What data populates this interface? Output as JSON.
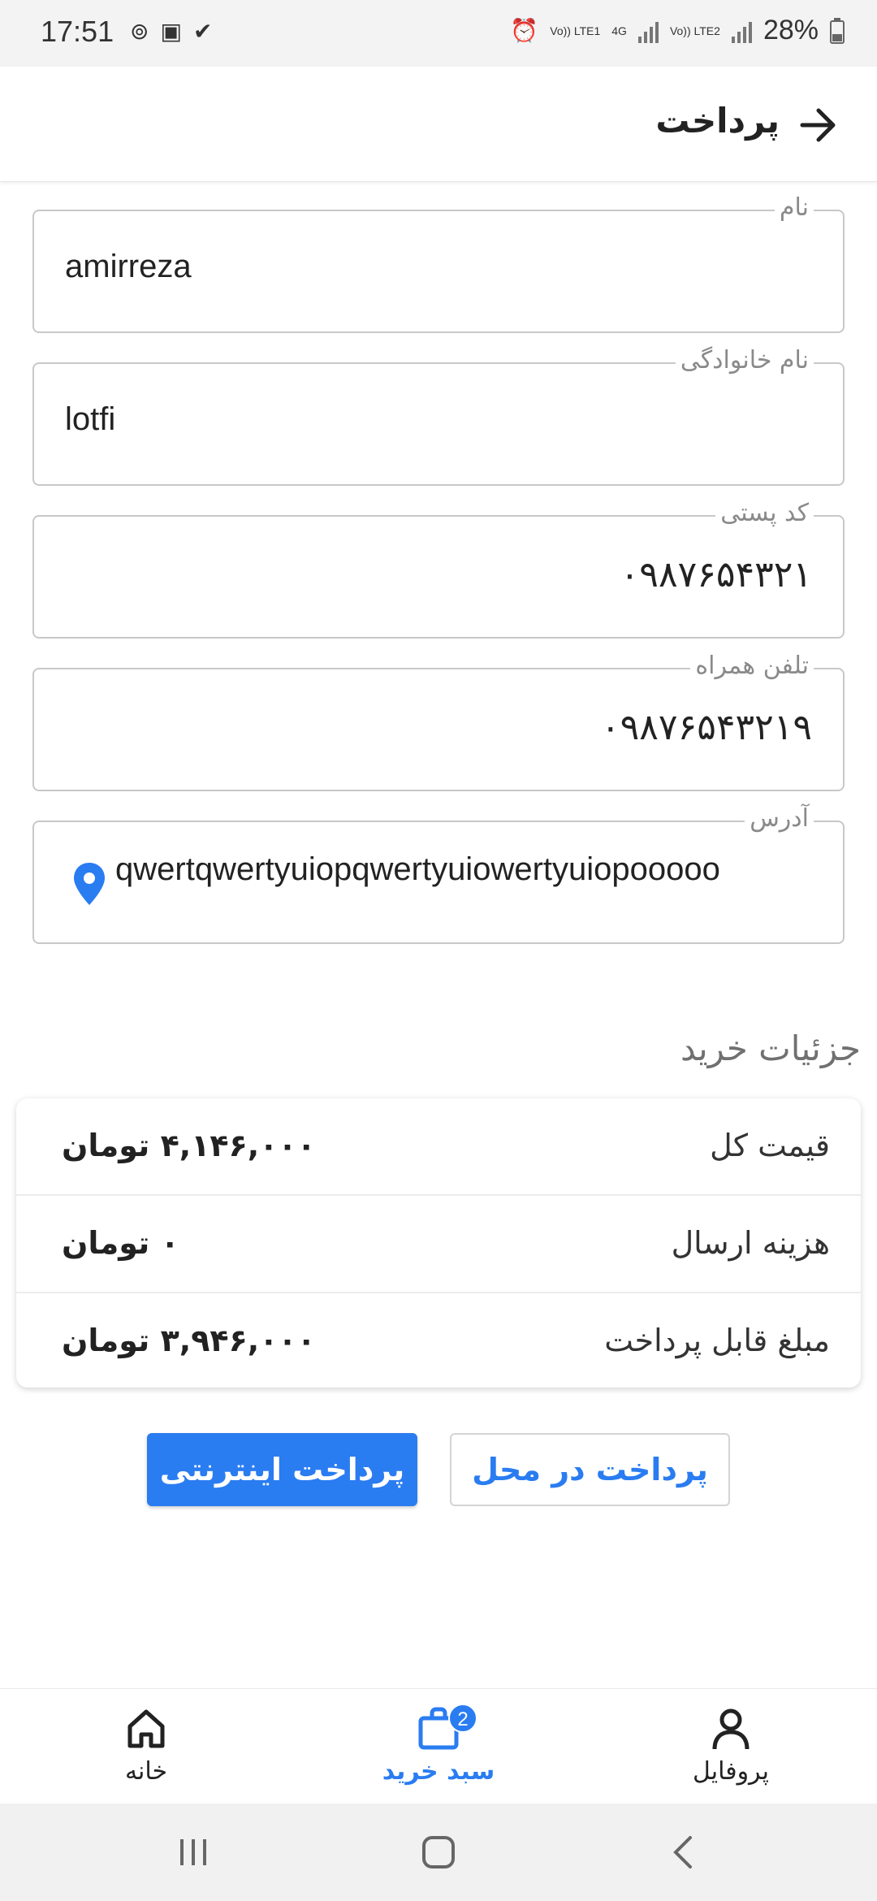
{
  "status_bar": {
    "time": "17:51",
    "battery": "28%",
    "sim1": "Vo)) LTE1",
    "sim2": "Vo)) LTE2",
    "network": "4G"
  },
  "header": {
    "title": "پرداخت",
    "back_icon": "arrow-right-icon"
  },
  "form": {
    "first_name": {
      "label": "نام",
      "value": "amirreza"
    },
    "last_name": {
      "label": "نام خانوادگی",
      "value": "lotfi"
    },
    "postal_code": {
      "label": "کد پستی",
      "value": "۰۹۸۷۶۵۴۳۲۱"
    },
    "mobile": {
      "label": "تلفن همراه",
      "value": "۰۹۸۷۶۵۴۳۲۱۹"
    },
    "address": {
      "label": "آدرس",
      "value": "qwertqwertyuiopqwertyuiowertyuiopooooo",
      "icon": "location-pin-icon"
    }
  },
  "details": {
    "title": "جزئیات خرید",
    "rows": [
      {
        "label": "قیمت کل",
        "value": "۴,۱۴۶,۰۰۰ تومان"
      },
      {
        "label": "هزینه ارسال",
        "value": "۰ تومان"
      },
      {
        "label": "مبلغ قابل پرداخت",
        "value": "۳,۹۴۶,۰۰۰ تومان"
      }
    ]
  },
  "actions": {
    "online_payment": "پرداخت اینترنتی",
    "pay_on_delivery": "پرداخت در محل"
  },
  "bottom_nav": {
    "items": [
      {
        "label": "خانه",
        "icon": "home-icon"
      },
      {
        "label": "سبد خرید",
        "icon": "shopping-bag-icon",
        "badge": "2",
        "active": true
      },
      {
        "label": "پروفایل",
        "icon": "user-icon"
      }
    ]
  },
  "colors": {
    "accent": "#2a7cf1",
    "label_gray": "#8a8a8a",
    "border_gray": "#c8c8c8"
  }
}
